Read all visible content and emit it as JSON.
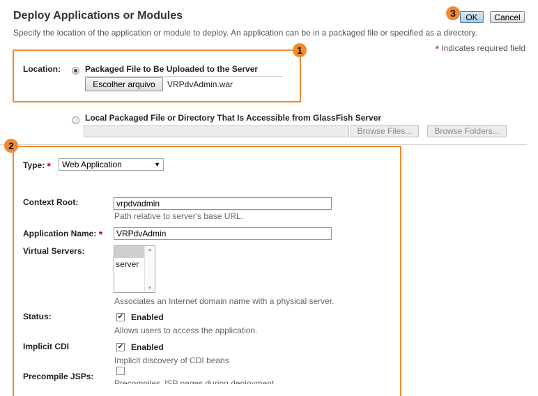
{
  "header": {
    "title": "Deploy Applications or Modules",
    "subtitle": "Specify the location of the application or module to deploy. An application can be in a packaged file or specified as a directory.",
    "required_mark": "*",
    "required_note": "Indicates required field",
    "ok_label": "OK",
    "cancel_label": "Cancel"
  },
  "callouts": {
    "one": "1",
    "two": "2",
    "three": "3"
  },
  "location": {
    "label": "Location:",
    "option_upload": "Packaged File to Be Uploaded to the Server",
    "choose_file_label": "Escolher arquivo",
    "file_name": "VRPdvAdmin.war",
    "option_local": "Local Packaged File or Directory That Is Accessible from GlassFish Server",
    "local_path_value": "",
    "browse_files_label": "Browse Files...",
    "browse_folders_label": "Browse Folders..."
  },
  "form": {
    "type_label": "Type:",
    "type_value": "Web Application",
    "context_root_label": "Context Root:",
    "context_root_value": "vrpdvadmin",
    "context_root_help": "Path relative to server's base URL.",
    "app_name_label": "Application Name:",
    "app_name_value": "VRPdvAdmin",
    "virtual_servers_label": "Virtual Servers:",
    "virtual_servers_items": [
      "",
      "server"
    ],
    "virtual_servers_help": "Associates an Internet domain name with a physical server.",
    "status_label": "Status:",
    "status_checkbox_label": "Enabled",
    "status_help": "Allows users to access the application.",
    "implicit_cdi_label": "Implicit CDI",
    "implicit_cdi_checkbox_label": "Enabled",
    "implicit_cdi_help": "Implicit discovery of CDI beans",
    "precompile_label": "Precompile JSPs:",
    "precompile_help": "Precompiles JSP pages during deployment"
  },
  "colors": {
    "callout": "#f08a30",
    "required": "#bb0000",
    "primary_button": "#a9cde8"
  }
}
